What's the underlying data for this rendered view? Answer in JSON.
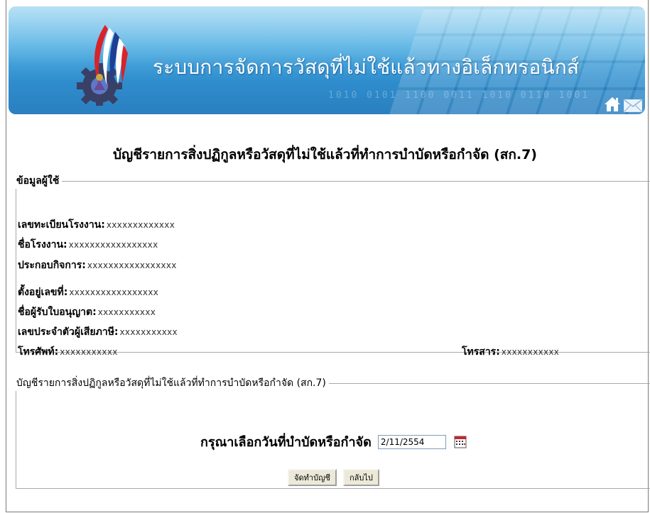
{
  "banner": {
    "title": "ระบบการจัดการวัสดุที่ไม่ใช้แล้วทางอิเล็กทรอนิกส์",
    "background_digits": "1010 0101 1100 0011 1010 0110 1001",
    "icons": {
      "home": "home-icon",
      "mail": "mail-icon",
      "logo": "gear-flag-logo"
    }
  },
  "page": {
    "title": "บัญชีรายการสิ่งปฏิกูลหรือวัสดุที่ไม่ใช้แล้วที่ทำการบำบัดหรือกำจัด (สก.7)"
  },
  "user_info": {
    "legend": "ข้อมูลผู้ใช้",
    "fields": [
      {
        "label": "เลขทะเบียนโรงงาน:",
        "value": "xxxxxxxxxxxxx"
      },
      {
        "label": "ชื่อโรงงาน:",
        "value": "xxxxxxxxxxxxxxxxx"
      },
      {
        "label": "ประกอบกิจการ:",
        "value": "xxxxxxxxxxxxxxxxx"
      },
      {
        "label": "ตั้งอยู่เลขที่:",
        "value": "xxxxxxxxxxxxxxxxx"
      },
      {
        "label": "ชื่อผู้รับใบอนุญาต:",
        "value": "xxxxxxxxxxx"
      },
      {
        "label": "เลขประจำตัวผู้เสียภาษี:",
        "value": "xxxxxxxxxxx"
      },
      {
        "label": "โทรศัพท์:",
        "value": "xxxxxxxxxxx"
      }
    ],
    "fax": {
      "label": "โทรสาร:",
      "value": "xxxxxxxxxxx"
    }
  },
  "list_section": {
    "legend": "บัญชีรายการสิ่งปฏิกูลหรือวัสดุที่ไม่ใช้แล้วที่ทำการบำบัดหรือกำจัด (สก.7)",
    "date_label": "กรุณาเลือกวันที่บำบัดหรือกำจัด",
    "date_value": "2/11/2554",
    "calendar_icon": "calendar-icon",
    "buttons": {
      "create": "จัดทำบัญชี",
      "back": "กลับไป"
    }
  },
  "colors": {
    "banner_top": "#8fd0f0",
    "banner_bottom": "#2a7fc0",
    "flag_red": "#d8232a",
    "flag_blue": "#1f3f95"
  }
}
